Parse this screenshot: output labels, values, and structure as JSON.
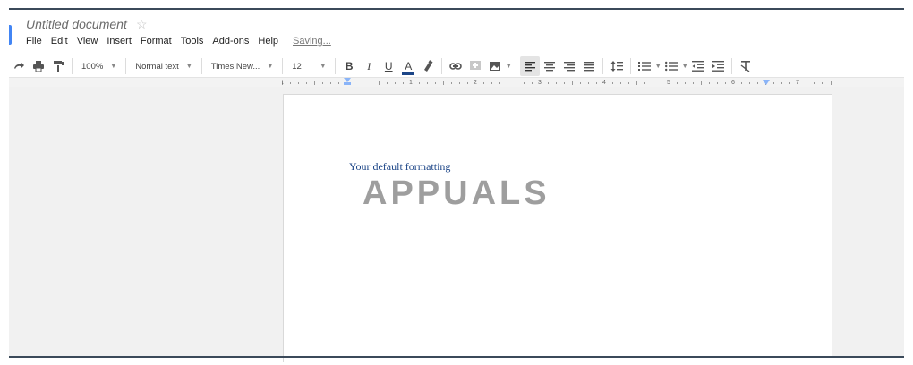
{
  "document": {
    "title": "Untitled document",
    "star_glyph": "☆",
    "status": "Saving..."
  },
  "menu": [
    "File",
    "Edit",
    "View",
    "Insert",
    "Format",
    "Tools",
    "Add-ons",
    "Help"
  ],
  "toolbar": {
    "zoom": "100%",
    "style": "Normal text",
    "font": "Times New...",
    "font_size": "12",
    "bold": "B",
    "italic": "I",
    "underline": "U",
    "text_color": "A",
    "text_color_value": "#1c4587"
  },
  "ruler": {
    "numbers": [
      "1",
      "1",
      "2",
      "3",
      "4",
      "5",
      "6",
      "7"
    ]
  },
  "page": {
    "body_text": "Your default formatting"
  },
  "watermark": {
    "text": "APPUALS"
  },
  "colors": {
    "accent": "#4285f4",
    "text_blue": "#1c4587",
    "canvas": "#f1f1f1"
  }
}
